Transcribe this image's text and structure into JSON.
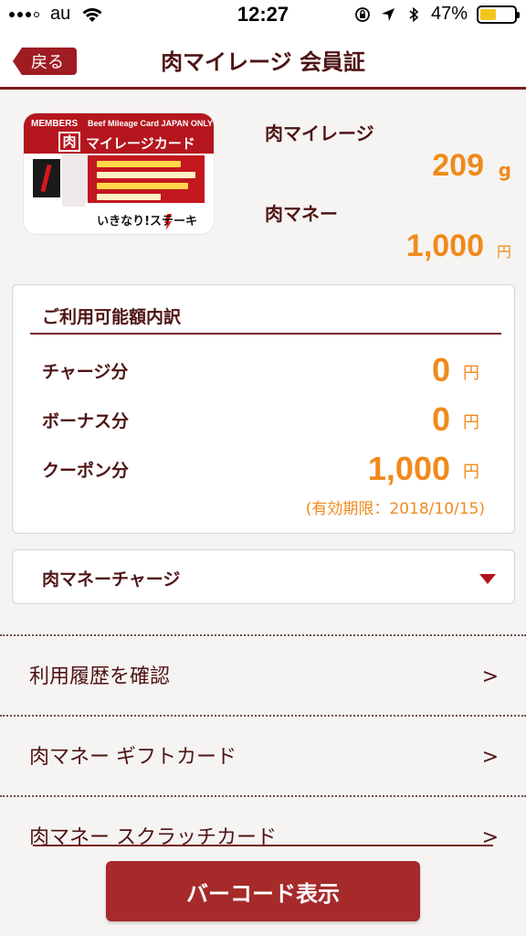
{
  "status_bar": {
    "carrier": "au",
    "time": "12:27",
    "battery": "47%",
    "battery_level": 0.47
  },
  "nav": {
    "back_label": "戻る",
    "title": "肉マイレージ 会員証"
  },
  "card": {
    "members": "MEMBERS",
    "beef": "Beef Mileage Card JAPAN ONLY",
    "niku": "肉",
    "name": "マイレージカード",
    "brand": "いきなり!ステーキ"
  },
  "summary": {
    "mileage_label": "肉マイレージ",
    "mileage_value": "209",
    "mileage_unit": "g",
    "money_label": "肉マネー",
    "money_value": "1,000",
    "money_unit": "円"
  },
  "breakdown": {
    "title": "ご利用可能額内訳",
    "rows": [
      {
        "label": "チャージ分",
        "value": "0",
        "unit": "円"
      },
      {
        "label": "ボーナス分",
        "value": "0",
        "unit": "円"
      },
      {
        "label": "クーポン分",
        "value": "1,000",
        "unit": "円"
      }
    ],
    "expiry": "(有効期限：2018/10/15)"
  },
  "charge": {
    "label": "肉マネーチャージ"
  },
  "menu": [
    {
      "label": "利用履歴を確認",
      "arrow": ">"
    },
    {
      "label": "肉マネー ギフトカード",
      "arrow": ">"
    },
    {
      "label": "肉マネー スクラッチカード",
      "arrow": ">"
    }
  ],
  "barcode_button": "バーコード表示",
  "colors": {
    "brand_red": "#a62a2a",
    "accent_orange": "#f08a1c",
    "text_maroon": "#4e1414"
  }
}
